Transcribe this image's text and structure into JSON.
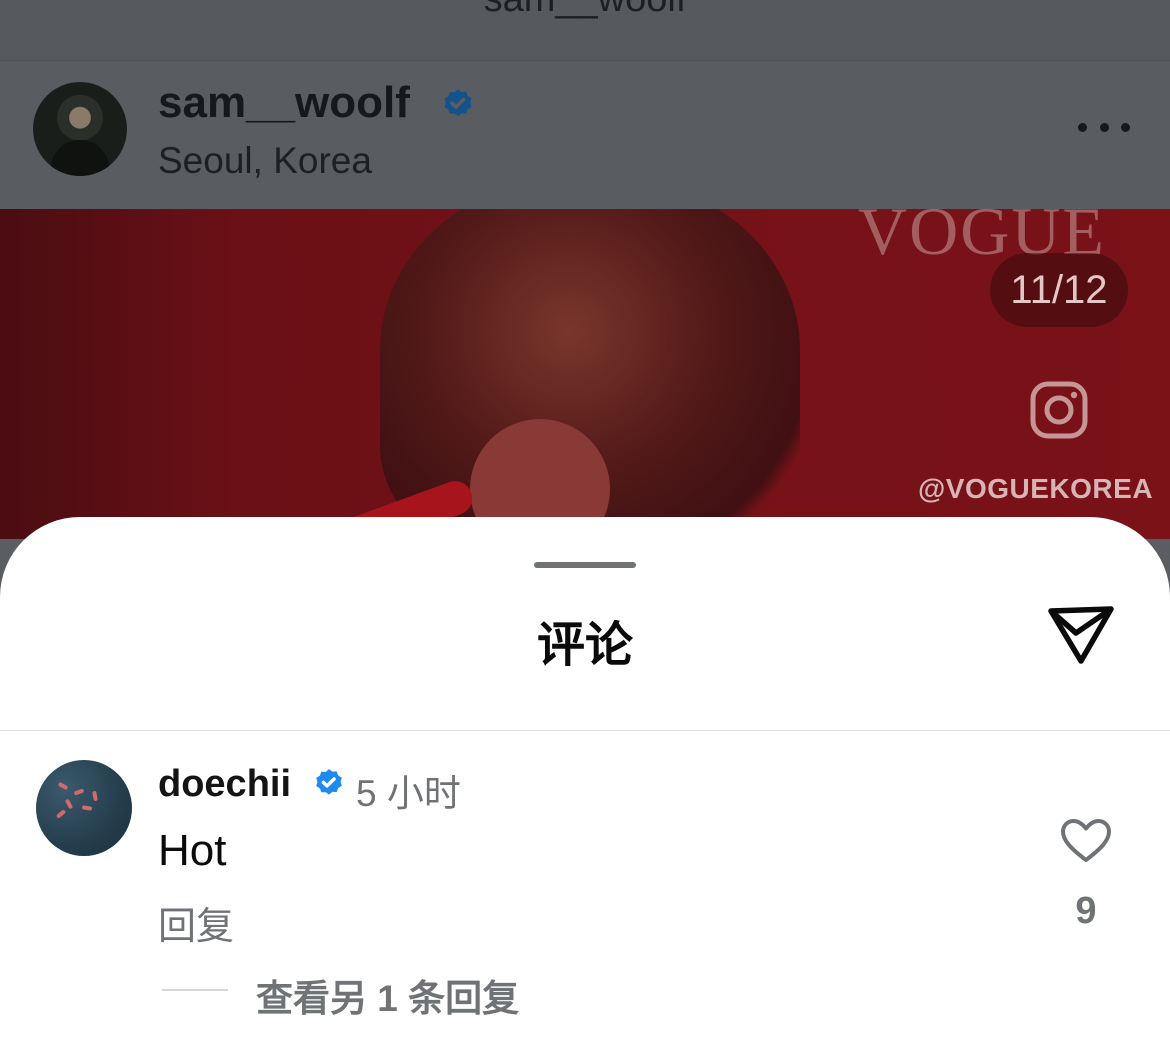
{
  "top_bar": {
    "title": "sam__woolf"
  },
  "post_header": {
    "username": "sam__woolf",
    "verified": true,
    "location": "Seoul, Korea",
    "more_icon": "more-horizontal-icon"
  },
  "media": {
    "logo_text": "VOGUE",
    "counter": "11/12",
    "brand_icon": "instagram-icon",
    "handle": "@VOGUEKOREA"
  },
  "comments_sheet": {
    "title": "评论",
    "share_icon": "send-icon",
    "comments": [
      {
        "username": "doechii",
        "verified": true,
        "time": "5 小时",
        "text": "Hot",
        "reply_label": "回复",
        "like_count": "9",
        "view_replies_label": "查看另 1 条回复"
      }
    ]
  },
  "colors": {
    "verified_blue": "#1f8bf0",
    "muted_text": "#6f7378",
    "media_red": "#741218"
  }
}
